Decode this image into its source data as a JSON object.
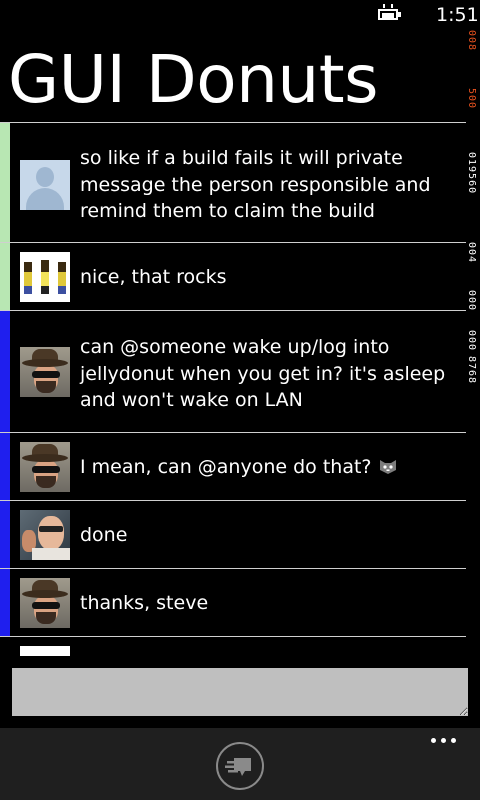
{
  "status_bar": {
    "time": "1:51",
    "battery_icon": "battery-charging-icon"
  },
  "app": {
    "title": "GUI Donuts"
  },
  "debug_counter": [
    "008",
    "500",
    "019560",
    "004",
    "000",
    "000",
    "8768"
  ],
  "messages": [
    {
      "text": "so like if a build fails it will private message the person responsible and remind them to claim the build",
      "avatar": "default-user-avatar",
      "bar_color": "#b8e7b3"
    },
    {
      "text": "nice, that rocks",
      "avatar": "pixel-art-avatar",
      "bar_color": "#b8e7b3"
    },
    {
      "text": "can @someone wake up/log into jellydonut when you get in? it's asleep and won't wake on LAN",
      "avatar": "hat-sunglasses-avatar",
      "bar_color": "#1f1fee"
    },
    {
      "text": "I mean, can @anyone do that?",
      "emoji": "cat-face-icon",
      "avatar": "hat-sunglasses-avatar",
      "bar_color": "#1f1fee"
    },
    {
      "text": "done",
      "avatar": "steve-avatar",
      "bar_color": "#1f1fee"
    },
    {
      "text": "thanks, steve",
      "avatar": "hat-sunglasses-avatar",
      "bar_color": "#1f1fee"
    }
  ],
  "composer": {
    "placeholder": "",
    "value": ""
  },
  "app_bar": {
    "send_icon": "send-message-icon",
    "more_icon": "more-dots-icon"
  }
}
